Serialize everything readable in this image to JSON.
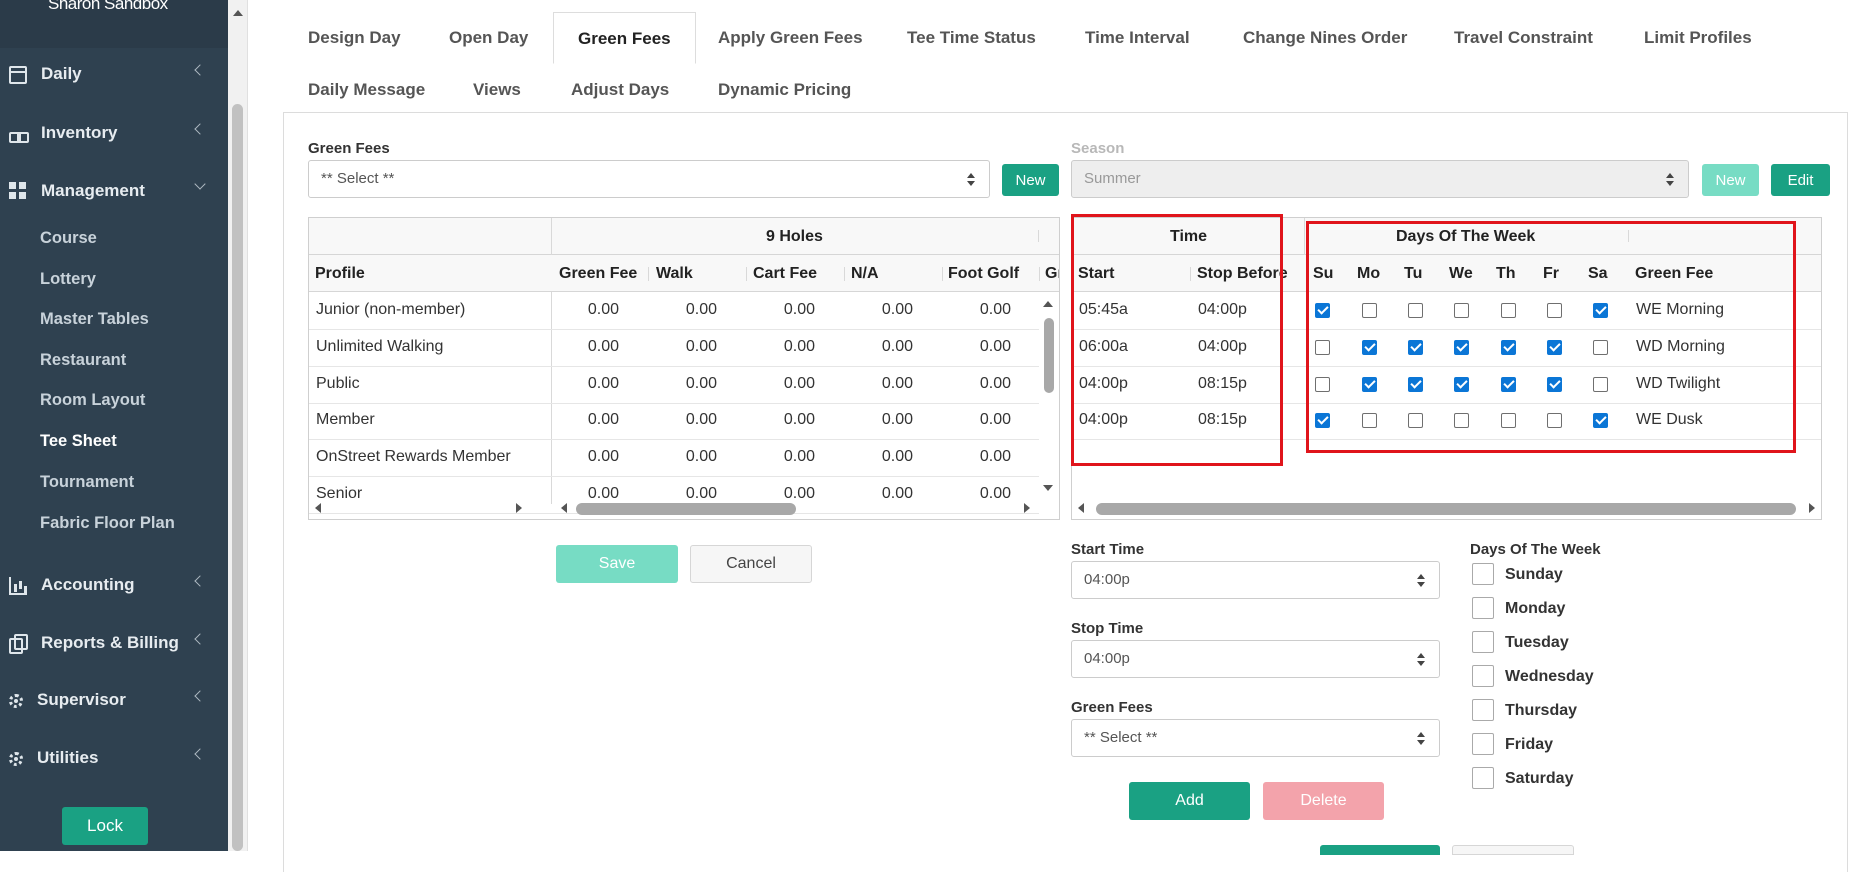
{
  "sidebar": {
    "org_name": "Sharon Sandbox",
    "items": [
      {
        "label": "Daily",
        "icon": "calendar-icon"
      },
      {
        "label": "Inventory",
        "icon": "cubes-icon"
      },
      {
        "label": "Management",
        "icon": "grid-icon"
      },
      {
        "label": "Accounting",
        "icon": "bar-chart-icon"
      },
      {
        "label": "Reports & Billing",
        "icon": "copy-icon"
      },
      {
        "label": "Supervisor",
        "icon": "gear-icon"
      },
      {
        "label": "Utilities",
        "icon": "gear-icon"
      }
    ],
    "management_sub": [
      "Course",
      "Lottery",
      "Master Tables",
      "Restaurant",
      "Room Layout",
      "Tee Sheet",
      "Tournament",
      "Fabric Floor Plan"
    ],
    "active_sub": "Tee Sheet",
    "lock_label": "Lock"
  },
  "tabs": {
    "row1": [
      "Design Day",
      "Open Day",
      "Green Fees",
      "Apply Green Fees",
      "Tee Time Status",
      "Time Interval",
      "Change Nines Order",
      "Travel Constraint",
      "Limit Profiles"
    ],
    "row2": [
      "Daily Message",
      "Views",
      "Adjust Days",
      "Dynamic Pricing"
    ],
    "active": "Green Fees"
  },
  "form": {
    "green_fees_label": "Green Fees",
    "green_fees_value": "** Select **",
    "new_label": "New",
    "season_label": "Season",
    "season_value": "Summer",
    "season_new_label": "New",
    "season_edit_label": "Edit"
  },
  "fees_grid": {
    "group_header": "9 Holes",
    "profile_header": "Profile",
    "columns": [
      "Green Fee",
      "Walk",
      "Cart Fee",
      "N/A",
      "Foot Golf",
      "Gr"
    ],
    "rows": [
      {
        "profile": "Junior (non-member)",
        "values": [
          "0.00",
          "0.00",
          "0.00",
          "0.00",
          "0.00"
        ]
      },
      {
        "profile": "Unlimited Walking",
        "values": [
          "0.00",
          "0.00",
          "0.00",
          "0.00",
          "0.00"
        ]
      },
      {
        "profile": "Public",
        "values": [
          "0.00",
          "0.00",
          "0.00",
          "0.00",
          "0.00"
        ]
      },
      {
        "profile": "Member",
        "values": [
          "0.00",
          "0.00",
          "0.00",
          "0.00",
          "0.00"
        ]
      },
      {
        "profile": "OnStreet Rewards Member",
        "values": [
          "0.00",
          "0.00",
          "0.00",
          "0.00",
          "0.00"
        ]
      },
      {
        "profile": "Senior",
        "values": [
          "0.00",
          "0.00",
          "0.00",
          "0.00",
          "0.00"
        ]
      }
    ],
    "save_label": "Save",
    "cancel_label": "Cancel"
  },
  "time_grid": {
    "time_header": "Time",
    "dow_header": "Days Of The Week",
    "start_header": "Start",
    "stop_header": "Stop Before",
    "day_headers": [
      "Su",
      "Mo",
      "Tu",
      "We",
      "Th",
      "Fr",
      "Sa"
    ],
    "fee_header": "Green Fee",
    "rows": [
      {
        "start": "05:45a",
        "stop": "04:00p",
        "days": [
          true,
          false,
          false,
          false,
          false,
          false,
          true
        ],
        "fee": "WE Morning"
      },
      {
        "start": "06:00a",
        "stop": "04:00p",
        "days": [
          false,
          true,
          true,
          true,
          true,
          true,
          false
        ],
        "fee": "WD Morning"
      },
      {
        "start": "04:00p",
        "stop": "08:15p",
        "days": [
          false,
          true,
          true,
          true,
          true,
          true,
          false
        ],
        "fee": "WD Twilight"
      },
      {
        "start": "04:00p",
        "stop": "08:15p",
        "days": [
          true,
          false,
          false,
          false,
          false,
          false,
          true
        ],
        "fee": "WE Dusk"
      }
    ]
  },
  "editor": {
    "start_time_label": "Start Time",
    "start_time_value": "04:00p",
    "stop_time_label": "Stop Time",
    "stop_time_value": "04:00p",
    "green_fees_label": "Green Fees",
    "green_fees_value": "** Select **",
    "add_label": "Add",
    "delete_label": "Delete",
    "dow_label": "Days Of The Week",
    "days": [
      "Sunday",
      "Monday",
      "Tuesday",
      "Wednesday",
      "Thursday",
      "Friday",
      "Saturday"
    ]
  },
  "colors": {
    "sidebar_bg": "#2f4150",
    "accent": "#1aa183",
    "checkbox": "#0b76d6",
    "highlight_box": "#e0141b"
  }
}
